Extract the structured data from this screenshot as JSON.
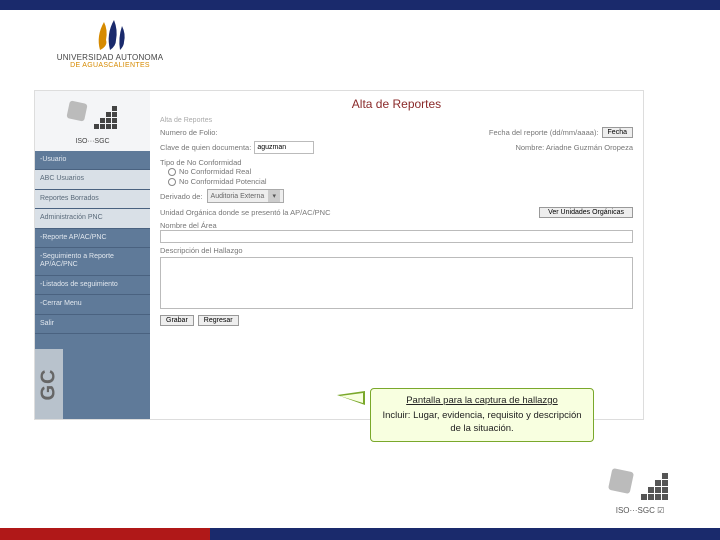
{
  "header": {
    "logo_line1": "UNIVERSIDAD AUTONOMA",
    "logo_line2": "DE AGUASCALIENTES"
  },
  "sidebar": {
    "iso_label": "ISO···SGC",
    "sgc_vert": "GC",
    "items": [
      {
        "label": "-Usuario"
      },
      {
        "label": "ABC Usuarios"
      },
      {
        "label": "Reportes Borrados"
      },
      {
        "label": "Administración PNC"
      },
      {
        "label": "-Reporte AP/AC/PNC"
      },
      {
        "label": "-Seguimiento a Reporte AP/AC/PNC"
      },
      {
        "label": "-Listados de seguimiento"
      },
      {
        "label": "-Cerrar Menu"
      },
      {
        "label": "Salir"
      }
    ]
  },
  "form": {
    "title": "Alta de Reportes",
    "alt_title": "Alta de Reportes",
    "folio_label": "Numero de Folio:",
    "fecha_label": "Fecha del reporte (dd/mm/aaaa):",
    "fecha_btn": "Fecha",
    "clave_label": "Clave de quien documenta:",
    "clave_value": "aguzman",
    "nombre_label": "Nombre: Ariadne Guzmán Oropeza",
    "tipo_label": "Tipo de No Conformidad",
    "radio1": "No Conformidad Real",
    "radio2": "No Conformidad Potencial",
    "derivado_label": "Derivado de:",
    "derivado_value": "Auditoria Externa",
    "unidad_label": "Unidad Orgánica donde se presentó la AP/AC/PNC",
    "ver_unidades": "Ver Unidades Orgánicas",
    "nombre_area_label": "Nombre del Área",
    "descripcion_label": "Descripción del Hallazgo",
    "grabar": "Grabar",
    "regresar": "Regresar"
  },
  "callout": {
    "line1": "Pantalla para la captura de hallazgo",
    "line2": "Incluir: Lugar, evidencia, requisito y descripción de la situación."
  },
  "footer": {
    "iso_label": "ISO···SGC ☑"
  }
}
